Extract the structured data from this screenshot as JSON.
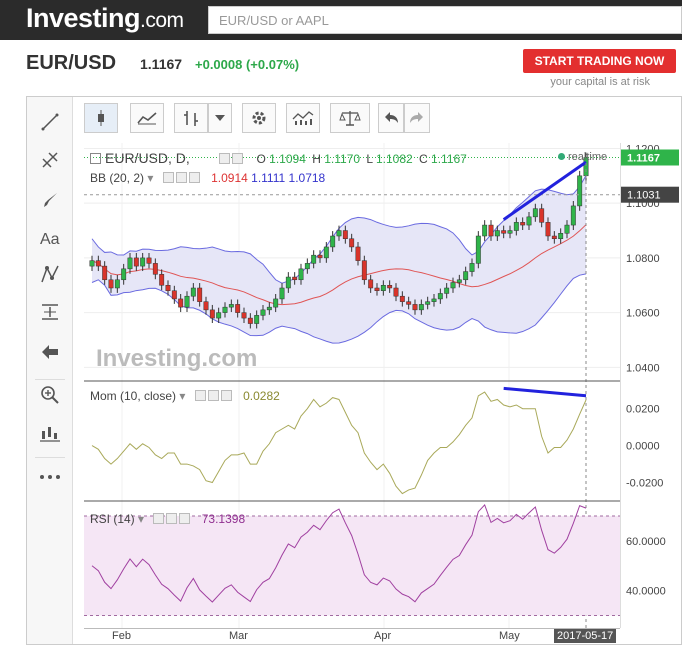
{
  "site": {
    "logo_text": "Investing",
    "logo_suffix": ".com",
    "search_placeholder": "EUR/USD or AAPL"
  },
  "quote": {
    "pair": "EUR/USD",
    "price": "1.1167",
    "change": "+0.0008 (+0.07%)",
    "trade_button": "START TRADING NOW",
    "risk_note": "your capital is at risk"
  },
  "legend": {
    "main": {
      "label": "EUR/USD, D,",
      "o_label": "O",
      "o": "1.1094",
      "h_label": "H",
      "h": "1.1170",
      "l_label": "L",
      "l": "1.1082",
      "c_label": "C",
      "c": "1.1167",
      "realtime": "realtime"
    },
    "bb": {
      "label": "BB (20, 2)",
      "v1": "1.0914",
      "v2": "1.1111",
      "v3": "1.0718"
    },
    "mom": {
      "label": "Mom (10, close)",
      "v": "0.0282"
    },
    "rsi": {
      "label": "RSI (14)",
      "v": "73.1398"
    }
  },
  "watermark": "Investing.com",
  "price_labels": {
    "last": "1.1167",
    "crosshair": "1.1031"
  },
  "axes": {
    "price_ticks": [
      "1.1200",
      "1.1000",
      "1.0800",
      "1.0600",
      "1.0400"
    ],
    "mom_ticks": [
      "0.0200",
      "0.0000",
      "-0.0200"
    ],
    "rsi_ticks": [
      "60.0000",
      "40.0000"
    ],
    "months": [
      "Feb",
      "Mar",
      "Apr",
      "May"
    ],
    "cursor_date": "2017-05-17"
  },
  "icons": {
    "left_tools": [
      "trend-line-icon",
      "fib-icon",
      "brush-icon",
      "text-icon",
      "pattern-icon",
      "measure-icon",
      "back-arrow-icon",
      "zoom-icon",
      "candles-icon",
      "more-icon"
    ],
    "toolbar": [
      "candlestick-icon",
      "area-chart-icon",
      "bar-chart-icon",
      "dropdown-icon",
      "settings-icon",
      "indicators-icon",
      "compare-icon",
      "undo-icon",
      "redo-icon"
    ]
  },
  "colors": {
    "up": "#2fb44a",
    "down": "#d9342b",
    "bb_mid": "#e05555",
    "bb_band": "#6a6ae0",
    "mom_line": "#a9a95a",
    "rsi_line": "#a040a0",
    "trend": "#2222dd"
  },
  "chart_data": {
    "type": "candlestick",
    "x_months": [
      "Feb",
      "Mar",
      "Apr",
      "May"
    ],
    "ylim": [
      1.035,
      1.122
    ],
    "close_series": [
      1.079,
      1.077,
      1.072,
      1.069,
      1.072,
      1.076,
      1.08,
      1.077,
      1.08,
      1.078,
      1.074,
      1.07,
      1.068,
      1.065,
      1.062,
      1.066,
      1.069,
      1.064,
      1.061,
      1.058,
      1.06,
      1.062,
      1.063,
      1.06,
      1.058,
      1.056,
      1.059,
      1.061,
      1.062,
      1.065,
      1.069,
      1.073,
      1.072,
      1.076,
      1.078,
      1.081,
      1.08,
      1.084,
      1.088,
      1.09,
      1.087,
      1.084,
      1.079,
      1.072,
      1.069,
      1.068,
      1.07,
      1.069,
      1.066,
      1.064,
      1.063,
      1.061,
      1.063,
      1.064,
      1.065,
      1.067,
      1.069,
      1.071,
      1.072,
      1.075,
      1.078,
      1.088,
      1.092,
      1.088,
      1.09,
      1.089,
      1.09,
      1.093,
      1.092,
      1.095,
      1.098,
      1.093,
      1.088,
      1.087,
      1.089,
      1.092,
      1.099,
      1.11,
      1.1167
    ],
    "mom_ylim": [
      -0.03,
      0.035
    ],
    "rsi_ylim": [
      25,
      76
    ]
  }
}
